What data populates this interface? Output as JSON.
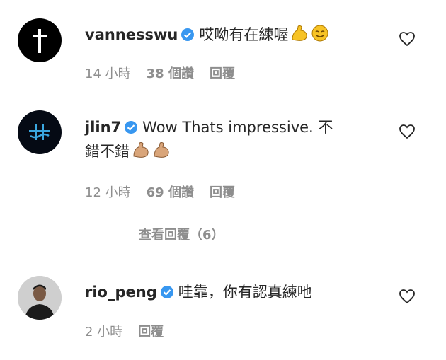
{
  "comments": [
    {
      "username": "vannesswu",
      "text": "哎呦有在練喔",
      "emojis": [
        "flexed-biceps-icon",
        "smiling-face-icon"
      ],
      "meta": {
        "time": "14 小時",
        "likes": "38 個讚",
        "reply": "回覆"
      }
    },
    {
      "username": "jlin7",
      "text_line1": "Wow Thats impressive. 不",
      "text_line2": "錯不錯",
      "emojis": [
        "flexed-biceps-icon",
        "flexed-biceps-icon"
      ],
      "meta": {
        "time": "12 小時",
        "likes": "69 個讚",
        "reply": "回覆"
      },
      "view_replies": "查看回覆（6）"
    },
    {
      "username": "rio_peng",
      "text": "哇靠，你有認真練吔",
      "meta": {
        "time": "2 小時",
        "reply": "回覆"
      }
    }
  ],
  "colors": {
    "verified": "#3897f0",
    "meta": "#8e8e8e",
    "text": "#262626"
  }
}
